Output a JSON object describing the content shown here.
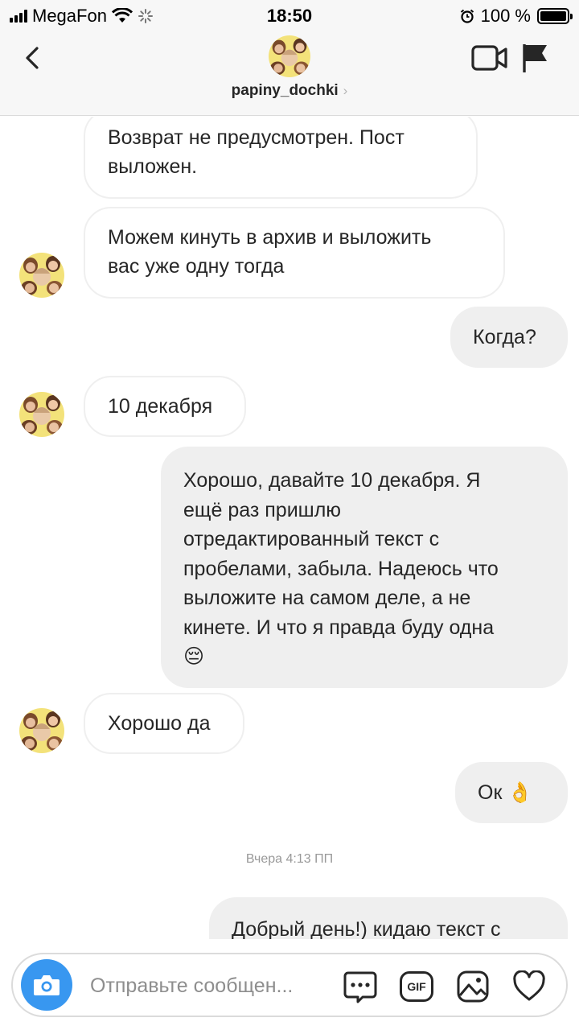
{
  "status_bar": {
    "carrier": "MegaFon",
    "time": "18:50",
    "battery": "100 %",
    "battery_level": 1.0
  },
  "header": {
    "username": "papiny_dochki",
    "chevron": "›"
  },
  "messages": [
    {
      "side": "in",
      "text_lines": [
        "Возврат не предусмотрен. Пост",
        "выложен."
      ]
    },
    {
      "side": "in",
      "text_lines": [
        "Можем кинуть в архив и выложить",
        "вас уже одну тогда"
      ],
      "avatar": true
    },
    {
      "side": "out",
      "text_lines": [
        "Когда?"
      ]
    },
    {
      "side": "in",
      "text_lines": [
        "10 декабря"
      ],
      "avatar": true
    },
    {
      "side": "out",
      "text_lines": [
        "Хорошо, давайте 10 декабря. Я",
        "ещё раз пришлю",
        "отредактированный текст с",
        "пробелами, забыла. Надеюсь что",
        "выложите на самом деле, а не",
        "кинете. И что я правда буду одна",
        "😔"
      ]
    },
    {
      "side": "in",
      "text_lines": [
        "Хорошо да"
      ],
      "avatar": true
    },
    {
      "side": "out",
      "text_lines": [
        "Ок 👌"
      ]
    },
    {
      "side": "out",
      "text_lines": [
        "Добрый день!) кидаю текст с"
      ]
    }
  ],
  "timestamp": "Вчера 4:13 ПП",
  "composer": {
    "placeholder": "Отправьте сообщен...",
    "gif_label": "GIF"
  },
  "icons": {
    "back": "chevron-left-icon",
    "video": "video-camera-icon",
    "flag": "flag-icon",
    "camera": "camera-icon",
    "sticker": "chat-bubble-icon",
    "gif": "gif-icon",
    "gallery": "image-icon",
    "like": "heart-icon"
  },
  "colors": {
    "accent": "#3897f0",
    "outgoing_bubble": "#efefef",
    "incoming_border": "#efefef",
    "header_bg": "#f7f7f7"
  }
}
